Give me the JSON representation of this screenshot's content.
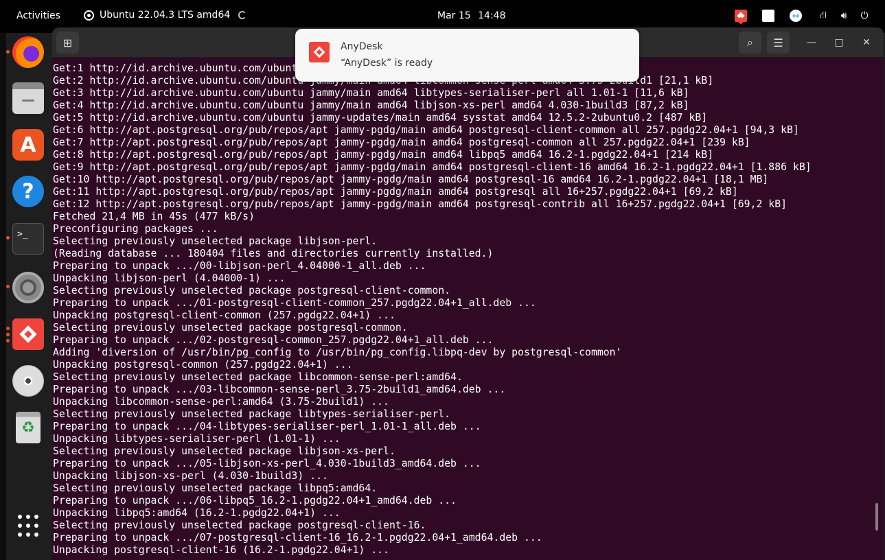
{
  "topbar": {
    "activities": "Activities",
    "vm_name": "Ubuntu 22.04.3 LTS amd64",
    "date": "Mar 15",
    "time": "14:48",
    "tray_icons": [
      "anydesk-icon",
      "remmina-icon",
      "teamviewer-icon",
      "network-icon",
      "volume-icon",
      "power-icon"
    ]
  },
  "dock": {
    "items": [
      "firefox",
      "files",
      "app-center",
      "help",
      "terminal",
      "settings",
      "anydesk",
      "disc",
      "trash",
      "show-applications"
    ],
    "terminal_glyph": ">_",
    "trash_glyph": "♻",
    "help_glyph": "?",
    "appcenter_glyph": "A"
  },
  "window": {
    "newtab_glyph": "⊞",
    "search_glyph": "⌕",
    "menu_glyph": "☰",
    "min_glyph": "—",
    "max_glyph": "□",
    "close_glyph": "✕"
  },
  "notification": {
    "app": "AnyDesk",
    "message": "“AnyDesk” is ready"
  },
  "terminal_lines": [
    "Get:1 http://id.archive.ubuntu.com/ubuntu jammy/main amd64 libjson-perl all 4.04000-1 [81,0 kB]",
    "Get:2 http://id.archive.ubuntu.com/ubuntu jammy/main amd64 libcommon-sense-perl amd64 3.75-2build1 [21,1 kB]",
    "Get:3 http://id.archive.ubuntu.com/ubuntu jammy/main amd64 libtypes-serialiser-perl all 1.01-1 [11,6 kB]",
    "Get:4 http://id.archive.ubuntu.com/ubuntu jammy/main amd64 libjson-xs-perl amd64 4.030-1build3 [87,2 kB]",
    "Get:5 http://id.archive.ubuntu.com/ubuntu jammy-updates/main amd64 sysstat amd64 12.5.2-2ubuntu0.2 [487 kB]",
    "Get:6 http://apt.postgresql.org/pub/repos/apt jammy-pgdg/main amd64 postgresql-client-common all 257.pgdg22.04+1 [94,3 kB]",
    "Get:7 http://apt.postgresql.org/pub/repos/apt jammy-pgdg/main amd64 postgresql-common all 257.pgdg22.04+1 [239 kB]",
    "Get:8 http://apt.postgresql.org/pub/repos/apt jammy-pgdg/main amd64 libpq5 amd64 16.2-1.pgdg22.04+1 [214 kB]",
    "Get:9 http://apt.postgresql.org/pub/repos/apt jammy-pgdg/main amd64 postgresql-client-16 amd64 16.2-1.pgdg22.04+1 [1.886 kB]",
    "Get:10 http://apt.postgresql.org/pub/repos/apt jammy-pgdg/main amd64 postgresql-16 amd64 16.2-1.pgdg22.04+1 [18,1 MB]",
    "Get:11 http://apt.postgresql.org/pub/repos/apt jammy-pgdg/main amd64 postgresql all 16+257.pgdg22.04+1 [69,2 kB]",
    "Get:12 http://apt.postgresql.org/pub/repos/apt jammy-pgdg/main amd64 postgresql-contrib all 16+257.pgdg22.04+1 [69,2 kB]",
    "Fetched 21,4 MB in 45s (477 kB/s)",
    "Preconfiguring packages ...",
    "Selecting previously unselected package libjson-perl.",
    "(Reading database ... 180404 files and directories currently installed.)",
    "Preparing to unpack .../00-libjson-perl_4.04000-1_all.deb ...",
    "Unpacking libjson-perl (4.04000-1) ...",
    "Selecting previously unselected package postgresql-client-common.",
    "Preparing to unpack .../01-postgresql-client-common_257.pgdg22.04+1_all.deb ...",
    "Unpacking postgresql-client-common (257.pgdg22.04+1) ...",
    "Selecting previously unselected package postgresql-common.",
    "Preparing to unpack .../02-postgresql-common_257.pgdg22.04+1_all.deb ...",
    "Adding 'diversion of /usr/bin/pg_config to /usr/bin/pg_config.libpq-dev by postgresql-common'",
    "Unpacking postgresql-common (257.pgdg22.04+1) ...",
    "Selecting previously unselected package libcommon-sense-perl:amd64.",
    "Preparing to unpack .../03-libcommon-sense-perl_3.75-2build1_amd64.deb ...",
    "Unpacking libcommon-sense-perl:amd64 (3.75-2build1) ...",
    "Selecting previously unselected package libtypes-serialiser-perl.",
    "Preparing to unpack .../04-libtypes-serialiser-perl_1.01-1_all.deb ...",
    "Unpacking libtypes-serialiser-perl (1.01-1) ...",
    "Selecting previously unselected package libjson-xs-perl.",
    "Preparing to unpack .../05-libjson-xs-perl_4.030-1build3_amd64.deb ...",
    "Unpacking libjson-xs-perl (4.030-1build3) ...",
    "Selecting previously unselected package libpq5:amd64.",
    "Preparing to unpack .../06-libpq5_16.2-1.pgdg22.04+1_amd64.deb ...",
    "Unpacking libpq5:amd64 (16.2-1.pgdg22.04+1) ...",
    "Selecting previously unselected package postgresql-client-16.",
    "Preparing to unpack .../07-postgresql-client-16_16.2-1.pgdg22.04+1_amd64.deb ...",
    "Unpacking postgresql-client-16 (16.2-1.pgdg22.04+1) ..."
  ],
  "colors": {
    "terminal_bg": "#300a24",
    "accent": "#e95420",
    "anydesk_red": "#ef443b"
  }
}
